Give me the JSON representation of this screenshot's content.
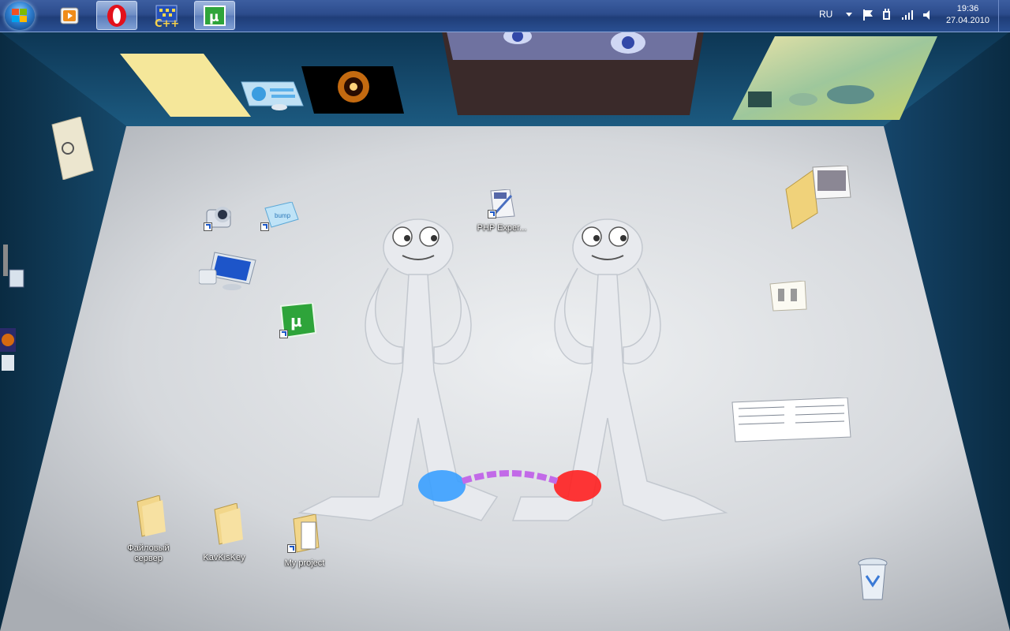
{
  "taskbar": {
    "start_button": "start-orb",
    "pinned": [
      {
        "name": "media-player",
        "icon": "media-player-icon"
      },
      {
        "name": "opera",
        "icon": "opera-icon",
        "active": true
      },
      {
        "name": "cpp-builder",
        "icon": "cpp-builder-icon"
      },
      {
        "name": "utorrent",
        "icon": "utorrent-icon",
        "active": true
      }
    ],
    "tray": {
      "language": "RU",
      "icons": [
        "flag-icon",
        "power-icon",
        "signal-icon",
        "volume-icon"
      ],
      "time": "19:36",
      "date": "27.04.2010"
    }
  },
  "desktop": {
    "icons": [
      {
        "label": "PHP Exper...",
        "icon": "php-expert-icon"
      },
      {
        "label": "Файловый сервер",
        "icon": "folder-icon"
      },
      {
        "label": "KavKisKey",
        "icon": "folder-icon"
      },
      {
        "label": "My project",
        "icon": "folder-shortcut-icon"
      }
    ],
    "unlabeled_icons": [
      "webcam-icon",
      "bumptop-icon",
      "computer-icon",
      "utorrent-desktop-icon",
      "document-stack-icon",
      "note-icon",
      "scanned-documents-icon",
      "recycle-bin-icon"
    ]
  },
  "colors": {
    "taskbar": "#2c4c8c",
    "wall": "#0e3550",
    "floor": "#d9dce0",
    "accent_blue": "#3aa0ff",
    "accent_red": "#ff2020"
  }
}
